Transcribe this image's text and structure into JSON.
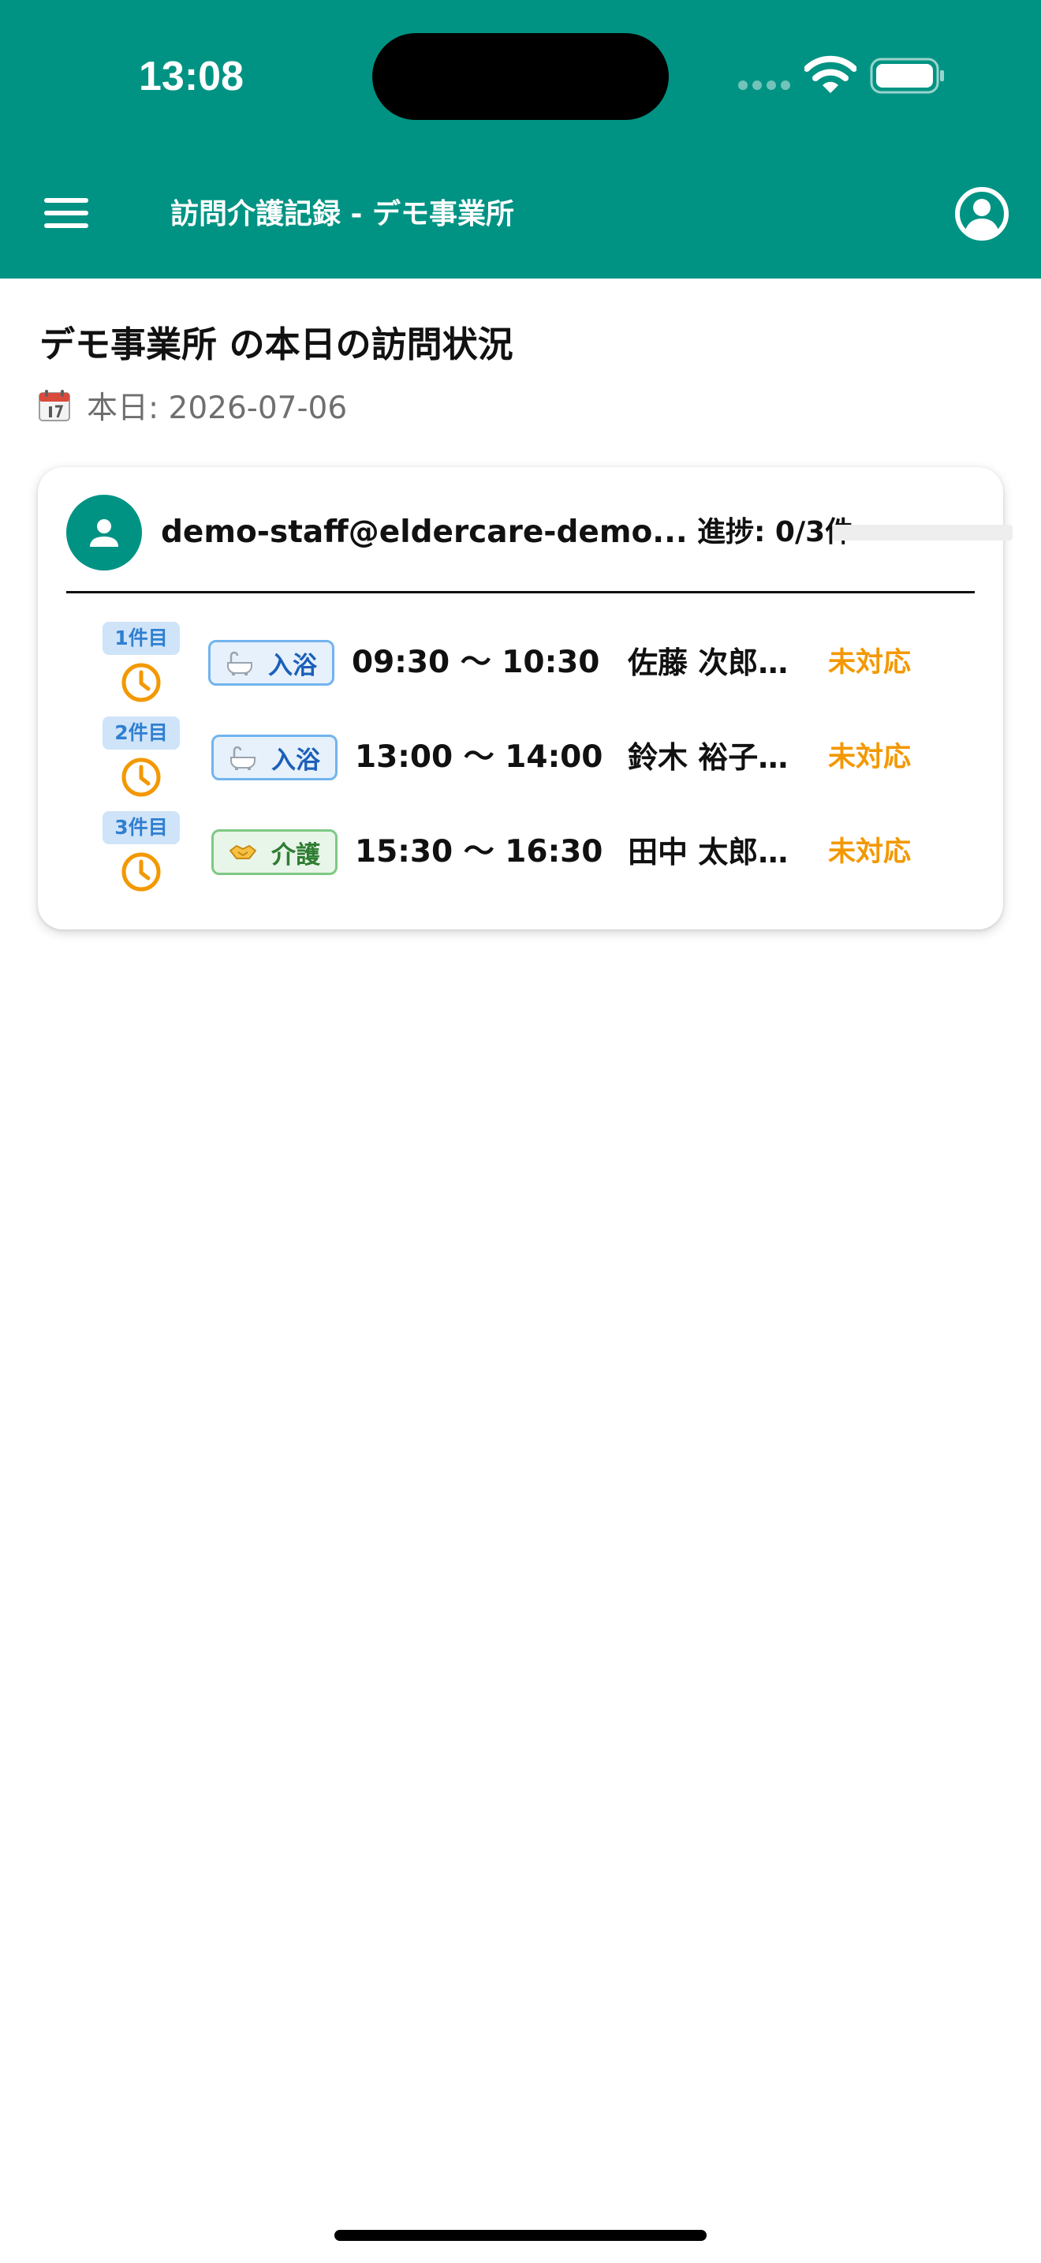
{
  "status_bar": {
    "time": "13:08"
  },
  "app_bar": {
    "title": "訪問介護記録 - デモ事業所",
    "menu_icon": "hamburger-menu-icon",
    "account_icon": "account-circle-icon"
  },
  "page": {
    "title": "デモ事業所 の本日の訪問状況",
    "date_text": "本日: 2026-07-06",
    "date_icon": "calendar-icon"
  },
  "staff_card": {
    "email": "demo-staff@eldercare-demo...",
    "progress_text": "進捗: 0/3件",
    "progress": 0,
    "visits": [
      {
        "order": "1件目",
        "service": "入浴",
        "service_icon": "bathtub-icon",
        "time": "09:30 〜 10:30",
        "client": "佐藤 次郎…",
        "status": "未対応"
      },
      {
        "order": "2件目",
        "service": "入浴",
        "service_icon": "bathtub-icon",
        "time": "13:00 〜 14:00",
        "client": "鈴木 裕子…",
        "status": "未対応"
      },
      {
        "order": "3件目",
        "service": "介護",
        "service_icon": "handshake-icon",
        "time": "15:30 〜 16:30",
        "client": "田中 太郎…",
        "status": "未対応"
      }
    ]
  },
  "colors": {
    "primary": "#009383",
    "status_pending": "#f39800",
    "order_badge_bg": "#cfe4f8",
    "bath_chip_border": "#72b4ee",
    "care_chip_border": "#7dc983"
  }
}
